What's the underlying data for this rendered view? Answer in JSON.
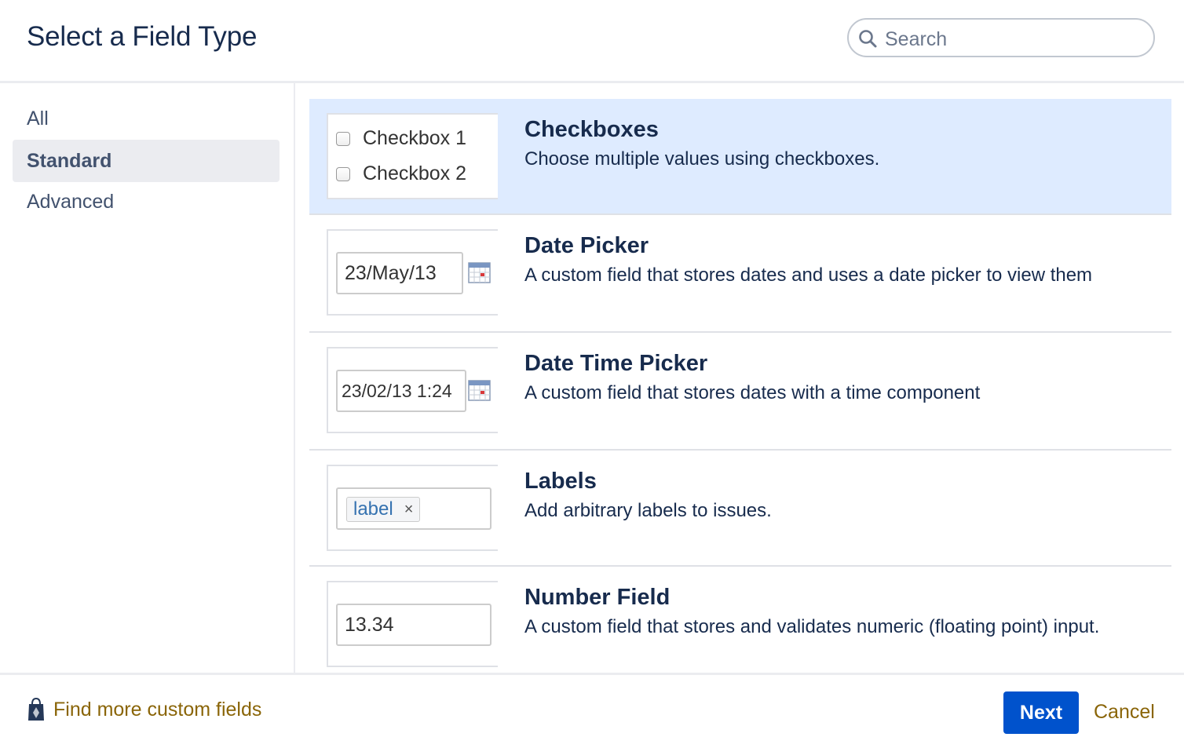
{
  "dialog": {
    "title": "Select a Field Type"
  },
  "search": {
    "placeholder": "Search",
    "icon": "search-icon"
  },
  "sidebar": {
    "items": [
      {
        "label": "All"
      },
      {
        "label": "Standard",
        "active": true
      },
      {
        "label": "Advanced"
      }
    ]
  },
  "fields": [
    {
      "title": "Checkboxes",
      "description": "Choose multiple values using checkboxes.",
      "selected": true,
      "preview": {
        "checkbox1": "Checkbox 1",
        "checkbox2": "Checkbox 2"
      }
    },
    {
      "title": "Date Picker",
      "description": "A custom field that stores dates and uses a date picker to view them",
      "preview": {
        "value": "23/May/13",
        "icon": "calendar-icon"
      }
    },
    {
      "title": "Date Time Picker",
      "description": "A custom field that stores dates with a time component",
      "preview": {
        "value": "23/02/13 1:24",
        "icon": "calendar-icon"
      }
    },
    {
      "title": "Labels",
      "description": "Add arbitrary labels to issues.",
      "preview": {
        "tag": "label",
        "remove": "×"
      }
    },
    {
      "title": "Number Field",
      "description": "A custom field that stores and validates numeric (floating point) input.",
      "preview": {
        "value": "13.34"
      }
    }
  ],
  "footer": {
    "find_link": "Find more custom fields",
    "find_icon": "marketplace-bag-icon",
    "next": "Next",
    "cancel": "Cancel"
  },
  "colors": {
    "primary": "#0052CC",
    "selected_bg": "#DEEBFF",
    "link": "#8A6508",
    "text": "#172B4D"
  }
}
